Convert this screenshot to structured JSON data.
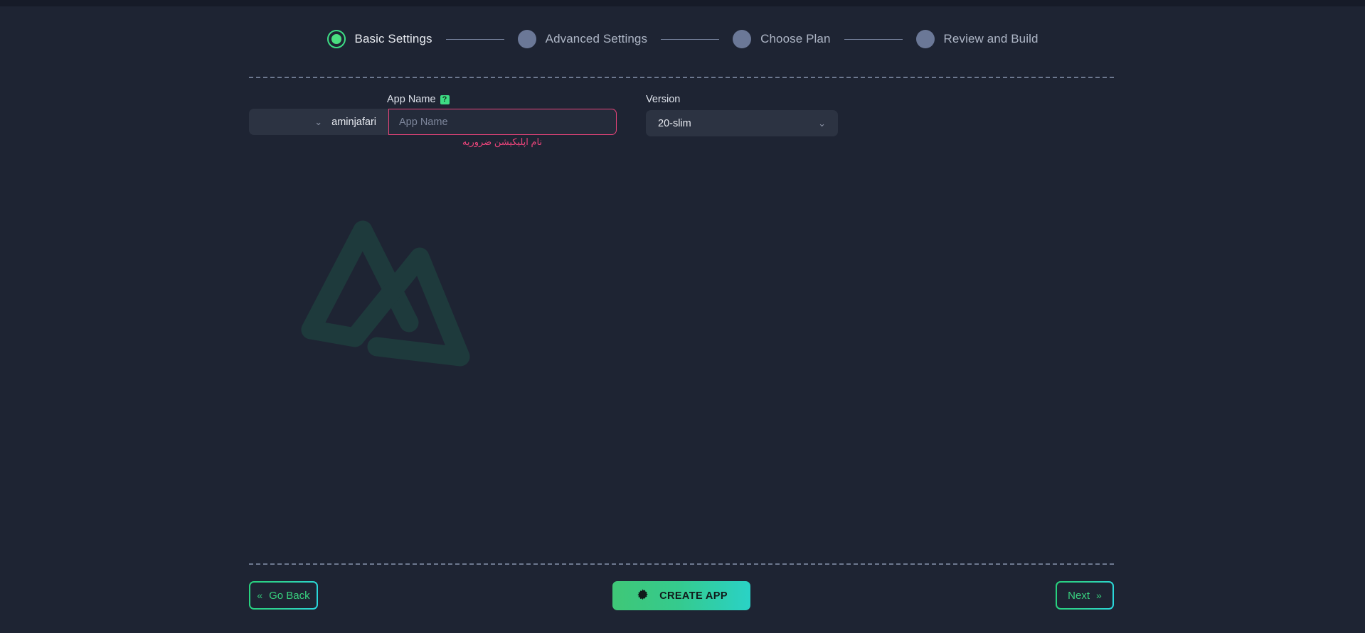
{
  "theme": {
    "background": "#1e2433",
    "top_strip": "#161b28",
    "accent_green": "#3ddc84",
    "accent_cyan": "#2ad7e0",
    "error": "#e8447a",
    "panel": "#2c3342",
    "text_primary": "#e9ecf2",
    "text_muted": "#aeb6c6"
  },
  "stepper": {
    "steps": [
      {
        "label": "Basic Settings",
        "state": "active",
        "icon": "step-dot-active-icon"
      },
      {
        "label": "Advanced Settings",
        "state": "inactive",
        "icon": "step-dot-icon"
      },
      {
        "label": "Choose Plan",
        "state": "inactive",
        "icon": "step-dot-icon"
      },
      {
        "label": "Review and Build",
        "state": "inactive",
        "icon": "step-dot-icon"
      }
    ]
  },
  "form": {
    "app_name": {
      "label": "App Name",
      "help_icon": "?",
      "help_icon_name": "help-badge-icon",
      "value": "",
      "placeholder": "App Name",
      "error": "نام اپلیکیشن ضروریه"
    },
    "owner": {
      "value": "aminjafari",
      "chevron": "⌄"
    },
    "version": {
      "label": "Version",
      "value": "20-slim",
      "chevron": "⌄"
    }
  },
  "footer": {
    "go_back": {
      "label": "Go Back",
      "chevron": "«"
    },
    "create_app": {
      "label": "CREATE APP",
      "icon": "gear-icon"
    },
    "next": {
      "label": "Next",
      "chevron": "»"
    }
  },
  "watermark": {
    "name": "brand-logo-watermark",
    "color": "#1d3a3a"
  }
}
